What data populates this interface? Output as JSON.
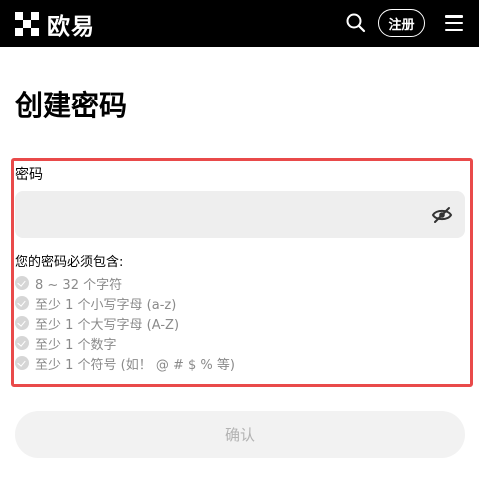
{
  "header": {
    "brand_name": "欧易",
    "logo_icon": "okx-checker-logo-icon",
    "search_icon": "search-icon",
    "register_label": "注册",
    "menu_icon": "hamburger-menu-icon",
    "background_color": "#000000"
  },
  "page": {
    "title": "创建密码"
  },
  "form": {
    "password_label": "密码",
    "password_value": "",
    "password_placeholder": "",
    "visibility_icon": "eye-slash-icon",
    "requirements_title": "您的密码必须包含:",
    "requirements": [
      "8 ~ 32 个字符",
      "至少 1 个小写字母 (a-z)",
      "至少 1 个大写字母 (A-Z)",
      "至少 1 个数字",
      "至少 1 个符号 (如！ @ # $ % 等)"
    ],
    "confirm_label": "确认",
    "highlight_color": "#e94a4a"
  }
}
